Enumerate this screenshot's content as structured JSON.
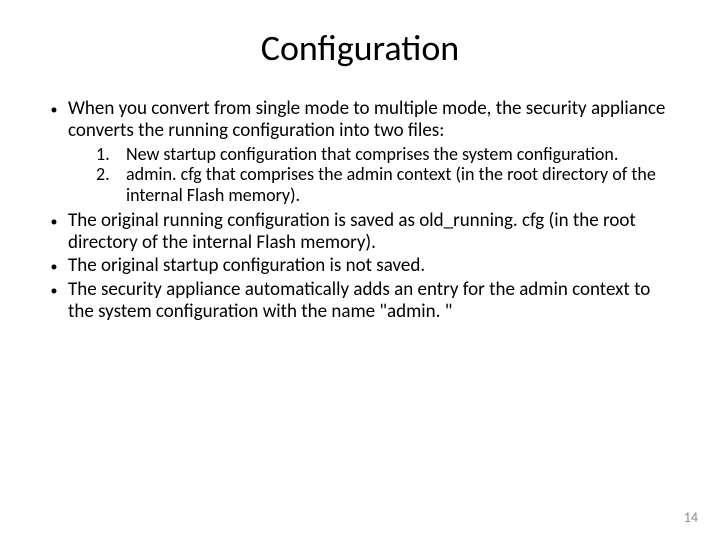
{
  "title": "Configuration",
  "bullets": [
    "When you convert from single mode to multiple mode, the security appliance converts the running configuration into two files:"
  ],
  "numbered": [
    "New startup configuration that comprises the system configuration.",
    "admin. cfg that comprises the admin context (in the root directory of the internal Flash memory)."
  ],
  "bullets2": [
    "The original running configuration is saved as old_running. cfg (in the root directory of the internal Flash memory).",
    "The original startup configuration is not saved.",
    "The security appliance automatically adds an entry for the admin context to the system configuration with the name \"admin. \""
  ],
  "pagenum": "14"
}
